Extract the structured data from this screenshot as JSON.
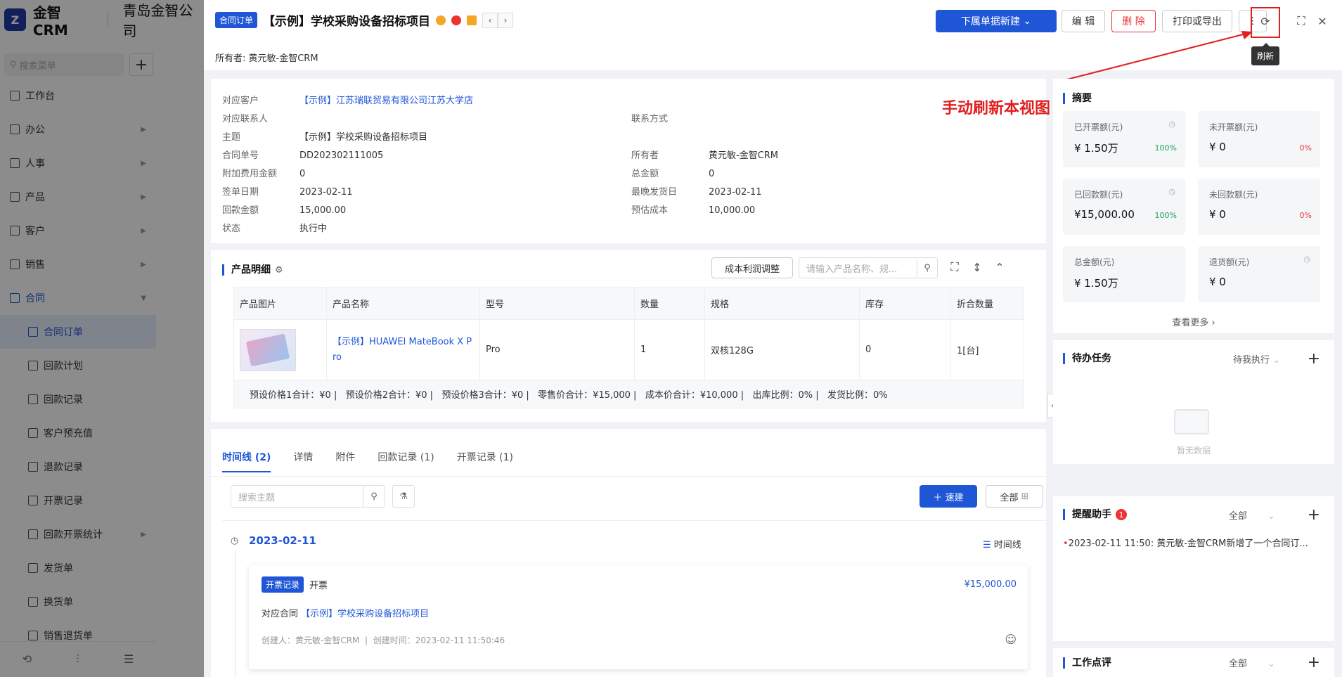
{
  "app": {
    "logo_text": "金智CRM",
    "company": "青岛金智公司"
  },
  "sidebar": {
    "search_placeholder": "搜索菜单",
    "items": [
      {
        "label": "工作台"
      },
      {
        "label": "办公"
      },
      {
        "label": "人事"
      },
      {
        "label": "产品"
      },
      {
        "label": "客户"
      },
      {
        "label": "销售"
      },
      {
        "label": "合同"
      }
    ],
    "sub_items": [
      {
        "label": "合同订单"
      },
      {
        "label": "回款计划"
      },
      {
        "label": "回款记录"
      },
      {
        "label": "客户预充值"
      },
      {
        "label": "退款记录"
      },
      {
        "label": "开票记录"
      },
      {
        "label": "回款开票统计"
      },
      {
        "label": "发货单"
      },
      {
        "label": "换货单"
      },
      {
        "label": "销售退货单"
      }
    ]
  },
  "header": {
    "type_tag": "合同订单",
    "title": "【示例】学校采购设备招标项目",
    "owner_line": "所有者: 黄元敏-金智CRM",
    "new_sub_label": "下属单据新建",
    "edit_label": "编 辑",
    "delete_label": "删 除",
    "print_label": "打印或导出",
    "refresh_tooltip": "刷新"
  },
  "annotation": "手动刷新本视图",
  "info": {
    "customer_k": "对应客户",
    "customer_v": "【示例】江苏瑞联贸易有限公司江苏大学店",
    "contact_k": "对应联系人",
    "contact_v": "",
    "contact_method_k": "联系方式",
    "contact_method_v": "",
    "subject_k": "主题",
    "subject_v": "【示例】学校采购设备招标项目",
    "no_k": "合同单号",
    "no_v": "DD202302111005",
    "owner_k": "所有者",
    "owner_v": "黄元敏-金智CRM",
    "extra_k": "附加费用金额",
    "extra_v": "0",
    "total_k": "总金额",
    "total_v": "0",
    "sign_k": "签单日期",
    "sign_v": "2023-02-11",
    "ship_k": "最晚发货日",
    "ship_v": "2023-02-11",
    "payback_k": "回款金额",
    "payback_v": "15,000.00",
    "cost_k": "预估成本",
    "cost_v": "10,000.00",
    "status_k": "状态",
    "status_v": "执行中"
  },
  "products": {
    "title": "产品明细",
    "adjust_label": "成本利润调整",
    "search_placeholder": "请输入产品名称、规...",
    "columns": [
      "产品图片",
      "产品名称",
      "型号",
      "数量",
      "规格",
      "库存",
      "折合数量"
    ],
    "row": {
      "name_line1": "【示例】HUAWEI MateBook X P",
      "name_line2": "ro",
      "model": "Pro",
      "qty": "1",
      "spec": "双核128G",
      "stock": "0",
      "equiv": "1[台]"
    },
    "summary": "预设价格1合计：¥0 |   预设价格2合计：¥0 |   预设价格3合计：¥0 |   零售价合计：¥15,000 |   成本价合计：¥10,000 |   出库比例：0% |   发货比例：0%"
  },
  "timeline": {
    "tabs": [
      "时间线 (2)",
      "详情",
      "附件",
      "回款记录 (1)",
      "开票记录 (1)"
    ],
    "search_placeholder": "搜索主题",
    "quick_new_label": "速建",
    "all_label": "全部",
    "date": "2023-02-11",
    "view_label": "时间线",
    "entry": {
      "tag": "开票记录",
      "type": "开票",
      "amount": "¥15,000.00",
      "contract_prefix": "对应合同",
      "contract_link": "【示例】学校采购设备招标项目",
      "creator": "创建人：黄元敏-金智CRM",
      "created": "创建时间：2023-02-11 11:50:46"
    }
  },
  "summary_panel": {
    "title": "摘要",
    "stats": [
      {
        "label": "已开票额(元)",
        "value": "¥ 1.50万",
        "pct": "100%"
      },
      {
        "label": "未开票额(元)",
        "value": "¥ 0",
        "pct": "0%"
      },
      {
        "label": "已回款额(元)",
        "value": "¥15,000.00",
        "pct": "100%"
      },
      {
        "label": "未回款额(元)",
        "value": "¥ 0",
        "pct": "0%"
      },
      {
        "label": "总金额(元)",
        "value": "¥ 1.50万",
        "pct": ""
      },
      {
        "label": "退货额(元)",
        "value": "¥ 0",
        "pct": ""
      }
    ],
    "more_label": "查看更多"
  },
  "todo_panel": {
    "title": "待办任务",
    "filter": "待我执行",
    "empty": "暂无数据"
  },
  "reminder_panel": {
    "title": "提醒助手",
    "badge": "1",
    "filter": "全部",
    "item": "2023-02-11 11:50: 黄元敏-金智CRM新增了一个合同订..."
  },
  "review_panel": {
    "title": "工作点评",
    "filter": "全部"
  },
  "colors": {
    "primary": "#1f56d6",
    "danger": "#e02020",
    "success": "#1aa55c"
  }
}
